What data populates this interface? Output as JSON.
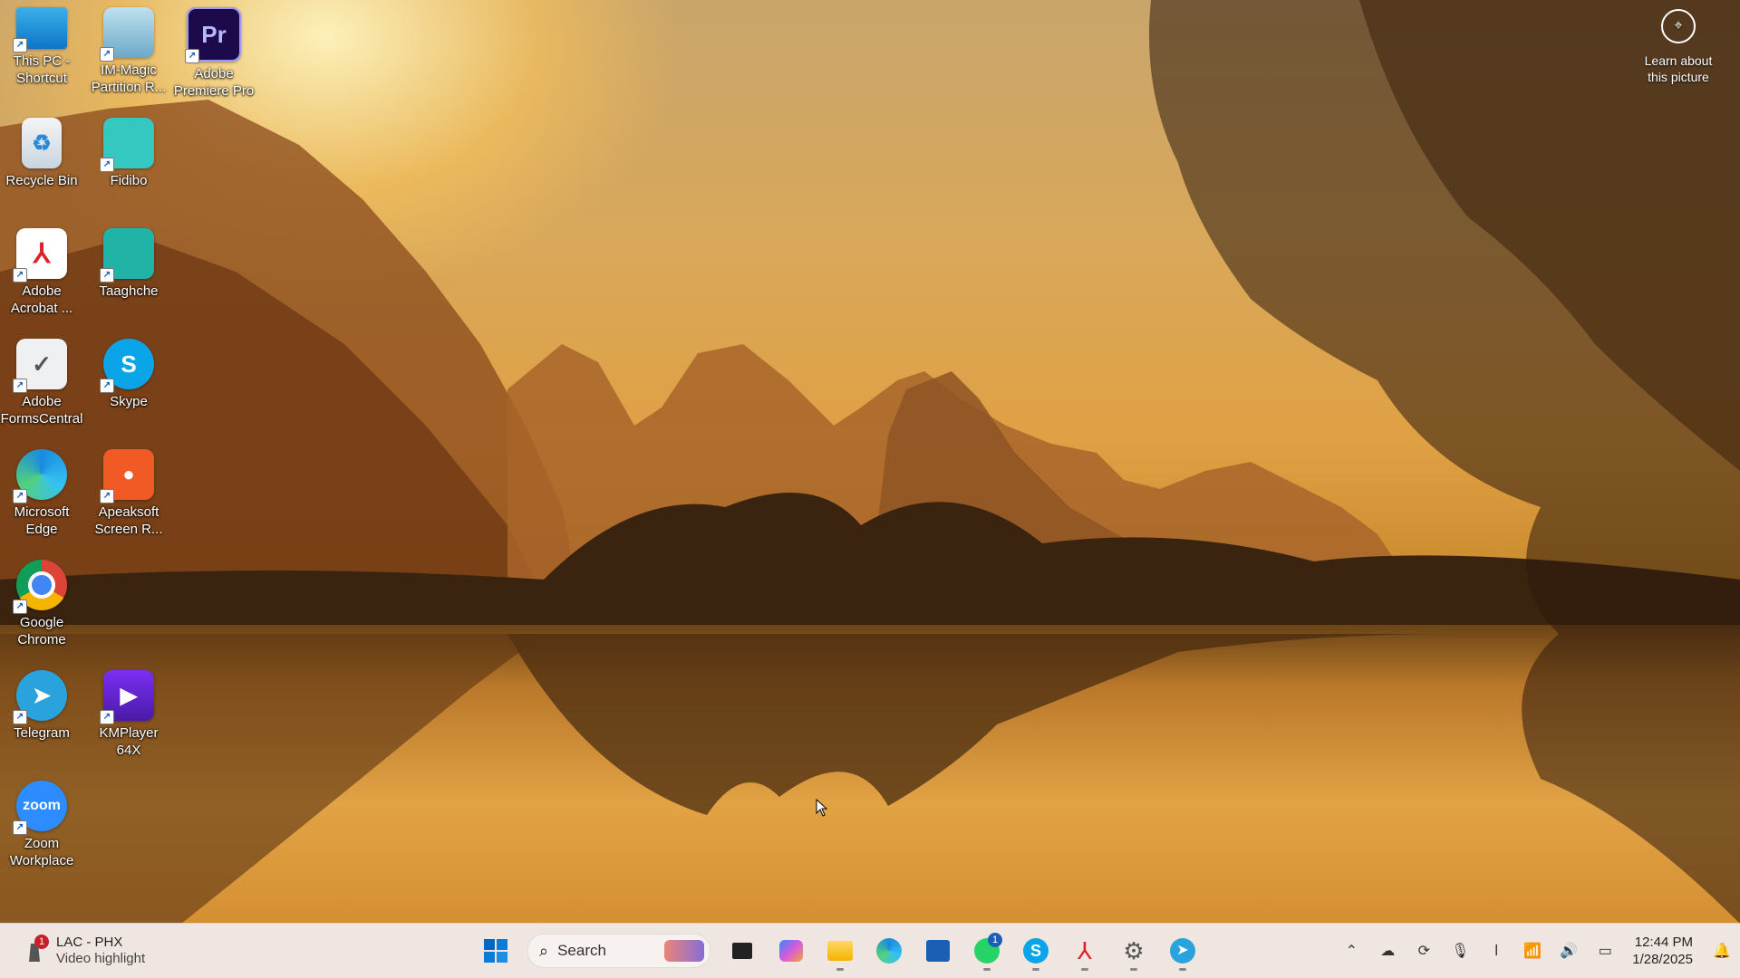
{
  "desktop": {
    "icons": [
      {
        "label": "This PC - Shortcut",
        "icon": "monitor-icon"
      },
      {
        "label": "IM-Magic Partition R...",
        "icon": "partition-icon"
      },
      {
        "label": "Adobe Premiere Pro",
        "icon": "premiere-icon",
        "glyph": "Pr"
      },
      {
        "label": "Recycle Bin",
        "icon": "recycle-bin-icon"
      },
      {
        "label": "Fidibo",
        "icon": "fidibo-icon"
      },
      {
        "label": "Adobe Acrobat ...",
        "icon": "acrobat-icon"
      },
      {
        "label": "Taaghche",
        "icon": "taaghche-icon"
      },
      {
        "label": "Adobe FormsCentral",
        "icon": "forms-icon"
      },
      {
        "label": "Skype",
        "icon": "skype-icon",
        "glyph": "S"
      },
      {
        "label": "Microsoft Edge",
        "icon": "edge-icon"
      },
      {
        "label": "Apeaksoft Screen R...",
        "icon": "apeaksoft-icon"
      },
      {
        "label": "Google Chrome",
        "icon": "chrome-icon"
      },
      {
        "label": "Telegram",
        "icon": "telegram-icon"
      },
      {
        "label": "KMPlayer 64X",
        "icon": "kmplayer-icon"
      },
      {
        "label": "Zoom Workplace",
        "icon": "zoom-icon",
        "glyph": "zoom"
      }
    ]
  },
  "learn_about": {
    "line1": "Learn about",
    "line2": "this picture"
  },
  "taskbar": {
    "notification": {
      "badge": "1",
      "title": "LAC - PHX",
      "subtitle": "Video highlight"
    },
    "search_label": "Search",
    "whatsapp_badge": "1",
    "clock": {
      "time": "12:44 PM",
      "date": "1/28/2025"
    }
  },
  "colors": {
    "taskbar_bg": "#efe6e2",
    "accent": "#0067c0"
  }
}
